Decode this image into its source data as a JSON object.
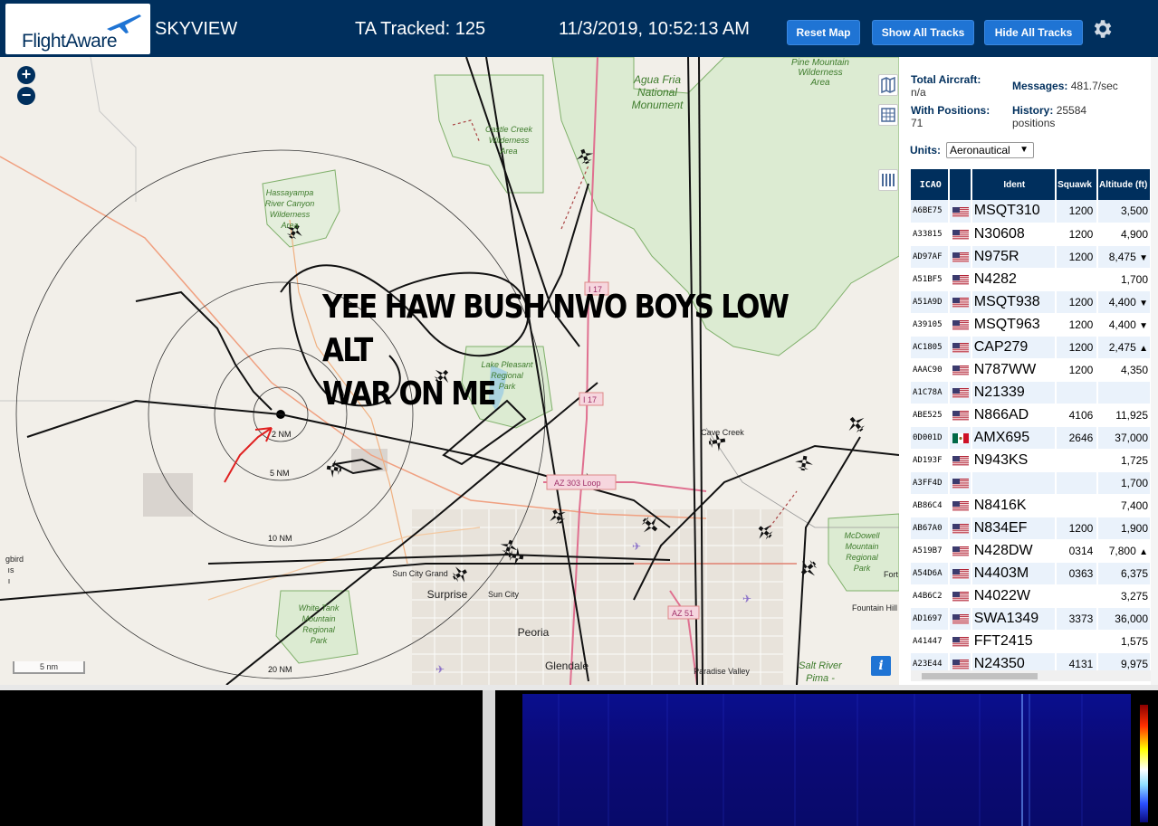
{
  "header": {
    "logo_text": "FlightAware",
    "app_name": "SKYVIEW",
    "tracked": "TA Tracked: 125",
    "datetime": "11/3/2019, 10:52:13 AM",
    "buttons": {
      "reset": "Reset Map",
      "show": "Show All Tracks",
      "hide": "Hide All Tracks"
    },
    "gear_icon": "gear-icon",
    "bg_color": "#002F5D",
    "button_color": "#1F74D4"
  },
  "map": {
    "zoom_in": "+",
    "zoom_out": "−",
    "annotation_line1": "YEE HAW BUSH NWO BOYS LOW ALT",
    "annotation_line2": "WAR ON ME",
    "scale": "5 nm",
    "info": "i",
    "range_labels": [
      "2 NM",
      "5 NM",
      "10 NM",
      "20 NM"
    ],
    "places": {
      "pine_mountain": [
        "Pine Mountain",
        "Wilderness",
        "Area"
      ],
      "agua_fria": [
        "Agua Fria",
        "National",
        "Monument"
      ],
      "castle_creek": [
        "Castle Creek",
        "Wilderness",
        "Area"
      ],
      "hassayampa": [
        "Hassayampa",
        "River Canyon",
        "Wilderness",
        "Area"
      ],
      "lake_pleasant": [
        "Lake Pleasant",
        "Regional",
        "Park"
      ],
      "white_tank": [
        "White Tank",
        "Mountain",
        "Regional",
        "Park"
      ],
      "mcdowell": [
        "McDowell",
        "Mountain",
        "Regional",
        "Park"
      ],
      "cave_creek": "Cave Creek",
      "sun_city_grand": "Sun City Grand",
      "surprise": "Surprise",
      "sun_city": "Sun City",
      "peoria": "Peoria",
      "glendale": "Glendale",
      "paradise_valley": "Paradise Valley",
      "fountain_hills": "Fountain Hill",
      "salt_river": [
        "Salt River",
        "Pima -"
      ],
      "fort": "Fort",
      "gbird": [
        "gbird",
        "ıs",
        "ı"
      ],
      "i17_north": "I 17",
      "i17_south": "I 17",
      "az303": "AZ 303 Loop",
      "az51": "AZ 51"
    }
  },
  "sidebar": {
    "total_aircraft_label": "Total Aircraft:",
    "total_aircraft_value": "n/a",
    "messages_label": "Messages:",
    "messages_value": "481.7/sec",
    "with_positions_label": "With Positions:",
    "with_positions_value": "71",
    "history_label": "History:",
    "history_value": "25584",
    "history_unit": "positions",
    "units_label": "Units:",
    "units_value": "Aeronautical",
    "columns": {
      "icao": "ICAO",
      "ident": "Ident",
      "squawk": "Squawk",
      "altitude": "Altitude (ft)"
    },
    "rows": [
      {
        "icao": "A6BE75",
        "flag": "us",
        "ident": "MSQT310",
        "squawk": "1200",
        "alt": "3,500",
        "trend": ""
      },
      {
        "icao": "A33815",
        "flag": "us",
        "ident": "N30608",
        "squawk": "1200",
        "alt": "4,900",
        "trend": ""
      },
      {
        "icao": "AD97AF",
        "flag": "us",
        "ident": "N975R",
        "squawk": "1200",
        "alt": "8,475",
        "trend": "▼"
      },
      {
        "icao": "A51BF5",
        "flag": "us",
        "ident": "N4282",
        "squawk": "",
        "alt": "1,700",
        "trend": ""
      },
      {
        "icao": "A51A9D",
        "flag": "us",
        "ident": "MSQT938",
        "squawk": "1200",
        "alt": "4,400",
        "trend": "▼"
      },
      {
        "icao": "A39105",
        "flag": "us",
        "ident": "MSQT963",
        "squawk": "1200",
        "alt": "4,400",
        "trend": "▼"
      },
      {
        "icao": "AC1805",
        "flag": "us",
        "ident": "CAP279",
        "squawk": "1200",
        "alt": "2,475",
        "trend": "▲"
      },
      {
        "icao": "AAAC90",
        "flag": "us",
        "ident": "N787WW",
        "squawk": "1200",
        "alt": "4,350",
        "trend": ""
      },
      {
        "icao": "A1C78A",
        "flag": "us",
        "ident": "N21339",
        "squawk": "",
        "alt": "",
        "trend": ""
      },
      {
        "icao": "ABE525",
        "flag": "us",
        "ident": "N866AD",
        "squawk": "4106",
        "alt": "11,925",
        "trend": ""
      },
      {
        "icao": "0D001D",
        "flag": "mx",
        "ident": "AMX695",
        "squawk": "2646",
        "alt": "37,000",
        "trend": ""
      },
      {
        "icao": "AD193F",
        "flag": "us",
        "ident": "N943KS",
        "squawk": "",
        "alt": "1,725",
        "trend": ""
      },
      {
        "icao": "A3FF4D",
        "flag": "us",
        "ident": "",
        "squawk": "",
        "alt": "1,700",
        "trend": ""
      },
      {
        "icao": "AB86C4",
        "flag": "us",
        "ident": "N8416K",
        "squawk": "",
        "alt": "7,400",
        "trend": ""
      },
      {
        "icao": "AB67A0",
        "flag": "us",
        "ident": "N834EF",
        "squawk": "1200",
        "alt": "1,900",
        "trend": ""
      },
      {
        "icao": "A519B7",
        "flag": "us",
        "ident": "N428DW",
        "squawk": "0314",
        "alt": "7,800",
        "trend": "▲"
      },
      {
        "icao": "A54D6A",
        "flag": "us",
        "ident": "N4403M",
        "squawk": "0363",
        "alt": "6,375",
        "trend": ""
      },
      {
        "icao": "A4B6C2",
        "flag": "us",
        "ident": "N4022W",
        "squawk": "",
        "alt": "3,275",
        "trend": ""
      },
      {
        "icao": "AD1697",
        "flag": "us",
        "ident": "SWA1349",
        "squawk": "3373",
        "alt": "36,000",
        "trend": ""
      },
      {
        "icao": "A41447",
        "flag": "us",
        "ident": "FFT2415",
        "squawk": "",
        "alt": "1,575",
        "trend": ""
      },
      {
        "icao": "A23E44",
        "flag": "us",
        "ident": "N24350",
        "squawk": "4131",
        "alt": "9,975",
        "trend": ""
      }
    ]
  }
}
